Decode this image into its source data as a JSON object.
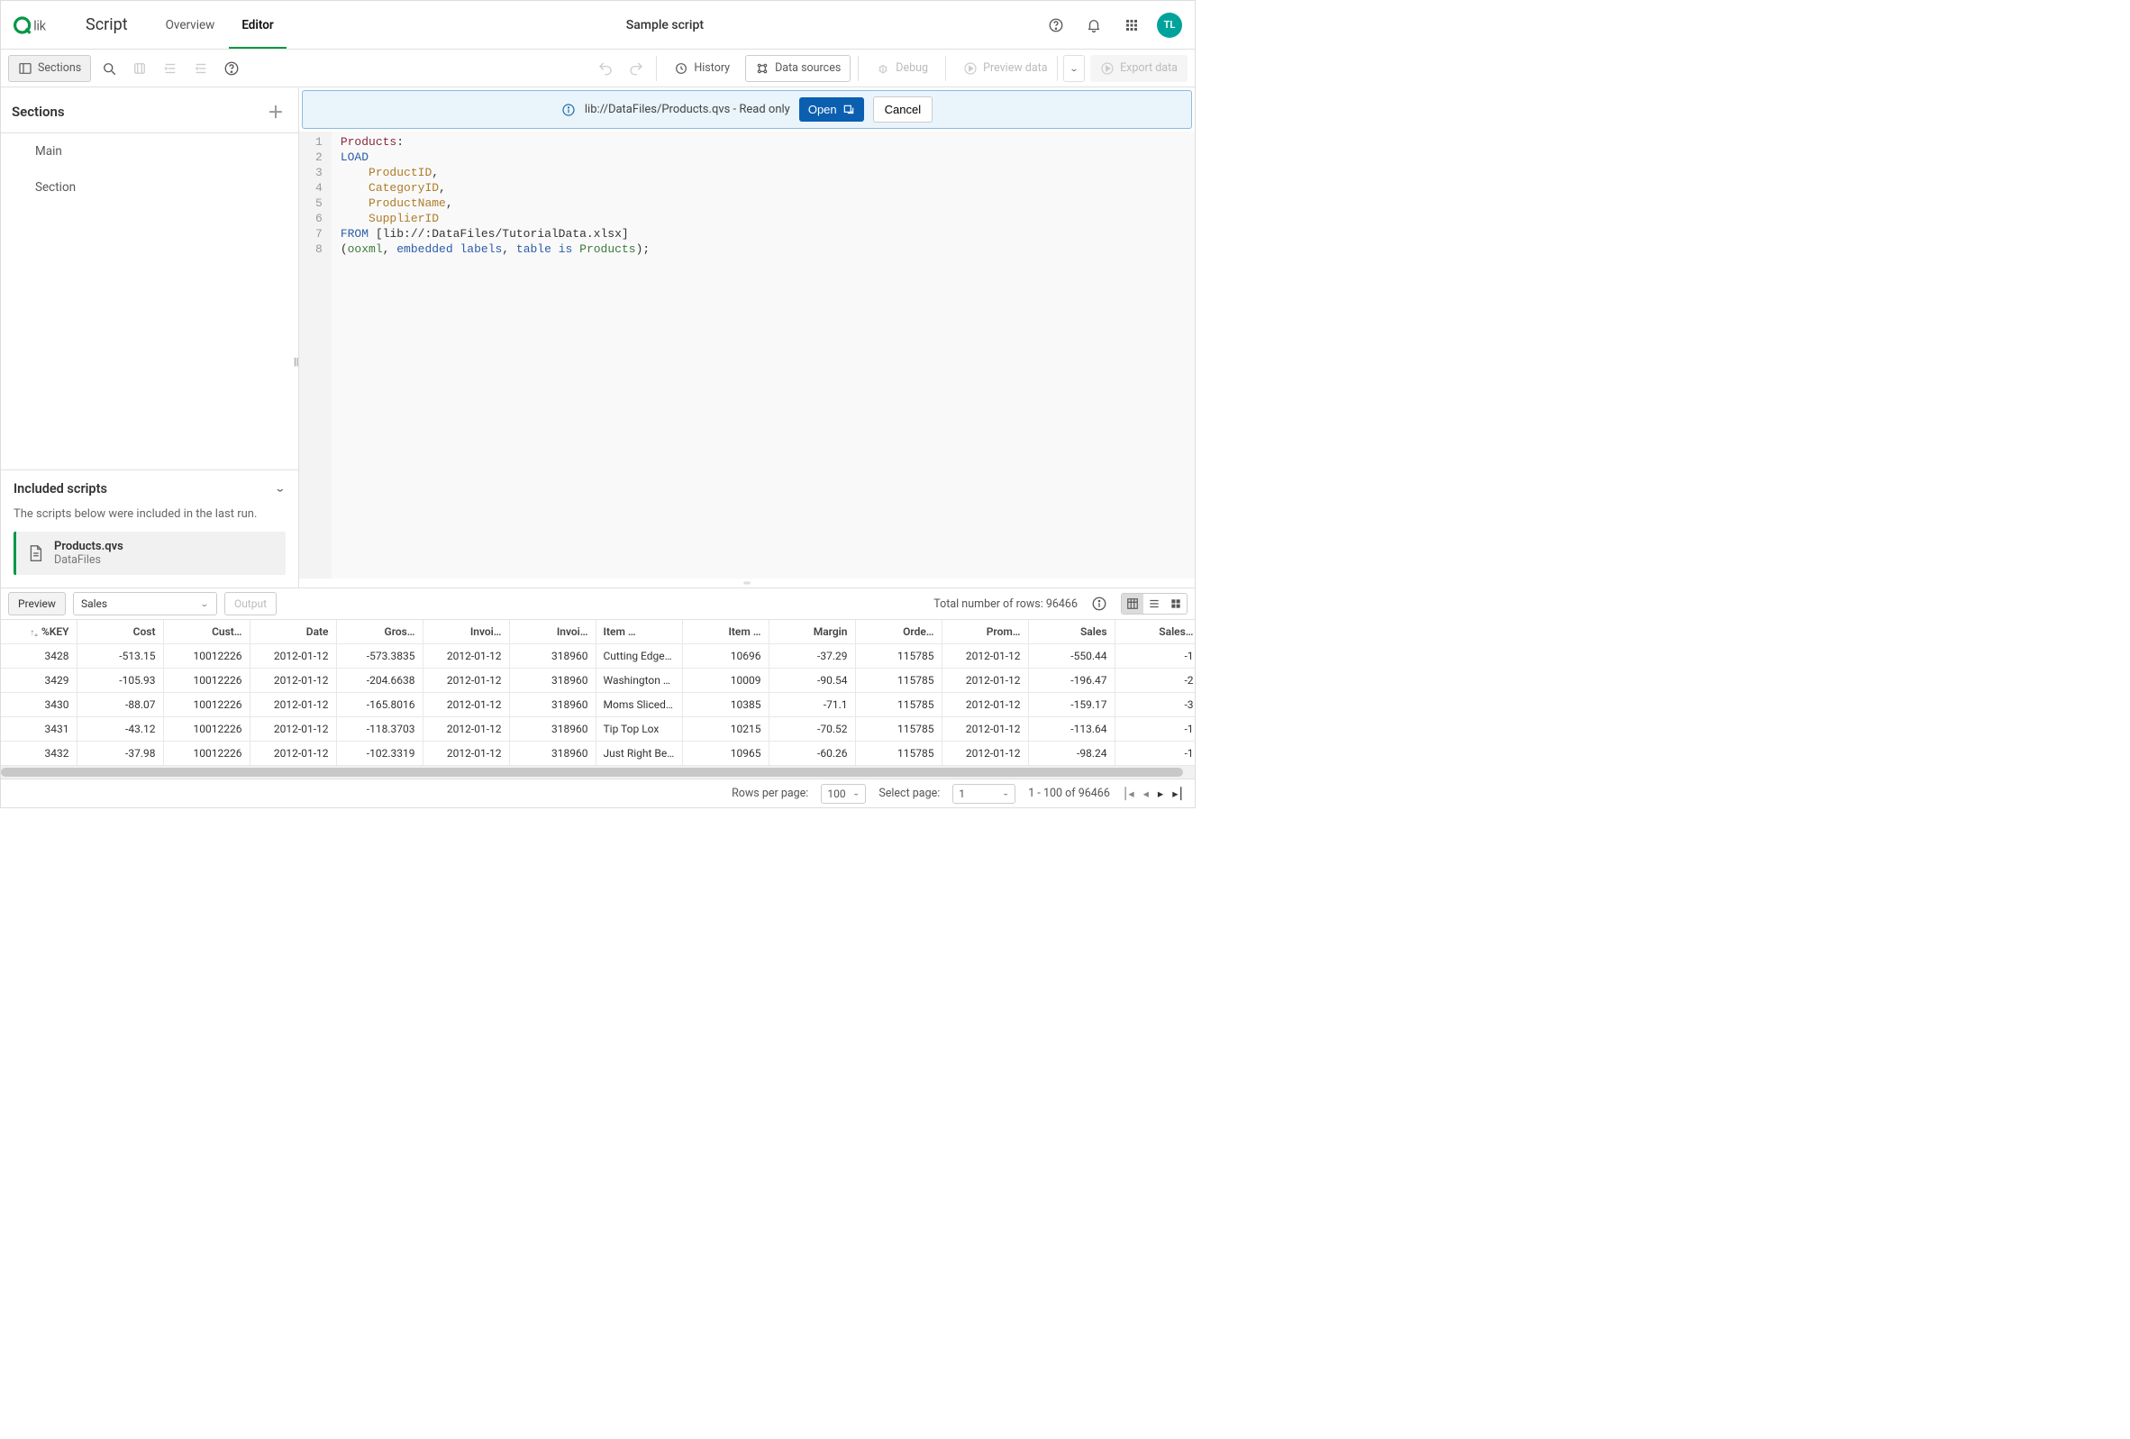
{
  "header": {
    "script_label": "Script",
    "tabs": [
      "Overview",
      "Editor"
    ],
    "active_tab": 1,
    "title": "Sample script",
    "avatar": "TL"
  },
  "toolbar": {
    "sections": "Sections",
    "history": "History",
    "data_sources": "Data sources",
    "debug": "Debug",
    "preview_data": "Preview data",
    "export_data": "Export data"
  },
  "sidebar": {
    "title": "Sections",
    "items": [
      "Main",
      "Section"
    ],
    "included": {
      "title": "Included scripts",
      "desc": "The scripts below were included in the last run.",
      "item": {
        "name": "Products.qvs",
        "loc": "DataFiles"
      }
    }
  },
  "banner": {
    "path": "lib://DataFiles/Products.qvs - Read only",
    "open": "Open",
    "cancel": "Cancel"
  },
  "code": {
    "lines": [
      {
        "n": 1,
        "tokens": [
          [
            "tab",
            "Products"
          ],
          [
            "p",
            ":"
          ]
        ]
      },
      {
        "n": 2,
        "tokens": [
          [
            "kw",
            "LOAD"
          ]
        ]
      },
      {
        "n": 3,
        "tokens": [
          [
            "p",
            "    "
          ],
          [
            "fld",
            "ProductID"
          ],
          [
            "p",
            ","
          ]
        ]
      },
      {
        "n": 4,
        "tokens": [
          [
            "p",
            "    "
          ],
          [
            "fld",
            "CategoryID"
          ],
          [
            "p",
            ","
          ]
        ]
      },
      {
        "n": 5,
        "tokens": [
          [
            "p",
            "    "
          ],
          [
            "fld",
            "ProductName"
          ],
          [
            "p",
            ","
          ]
        ]
      },
      {
        "n": 6,
        "tokens": [
          [
            "p",
            "    "
          ],
          [
            "fld",
            "SupplierID"
          ]
        ]
      },
      {
        "n": 7,
        "tokens": [
          [
            "kw",
            "FROM"
          ],
          [
            "p",
            " ["
          ],
          [
            "str",
            "lib://:DataFiles/TutorialData.xlsx"
          ],
          [
            "p",
            "]"
          ]
        ]
      },
      {
        "n": 8,
        "tokens": [
          [
            "p",
            "("
          ],
          [
            "fn",
            "ooxml"
          ],
          [
            "p",
            ", "
          ],
          [
            "kw",
            "embedded"
          ],
          [
            "p",
            " "
          ],
          [
            "kw",
            "labels"
          ],
          [
            "p",
            ", "
          ],
          [
            "kw",
            "table"
          ],
          [
            "p",
            " "
          ],
          [
            "kw",
            "is"
          ],
          [
            "p",
            " "
          ],
          [
            "fn",
            "Products"
          ],
          [
            "p",
            ");"
          ]
        ]
      }
    ]
  },
  "preview": {
    "tab": "Preview",
    "select": "Sales",
    "output": "Output",
    "rowcount_label": "Total number of rows:",
    "rowcount": "96466",
    "headers": [
      "%KEY",
      "Cost",
      "Cust…",
      "Date",
      "Gros…",
      "Invoi…",
      "Invoi…",
      "Item …",
      "Item …",
      "Margin",
      "Orde…",
      "Prom…",
      "Sales",
      "Sales…"
    ],
    "align_left": [
      7
    ],
    "rows": [
      [
        "3428",
        "-513.15",
        "10012226",
        "2012-01-12",
        "-573.3835",
        "2012-01-12",
        "318960",
        "Cutting Edge Slic",
        "10696",
        "-37.29",
        "115785",
        "2012-01-12",
        "-550.44",
        "-1"
      ],
      [
        "3429",
        "-105.93",
        "10012226",
        "2012-01-12",
        "-204.6638",
        "2012-01-12",
        "318960",
        "Washington Cran",
        "10009",
        "-90.54",
        "115785",
        "2012-01-12",
        "-196.47",
        "-2"
      ],
      [
        "3430",
        "-88.07",
        "10012226",
        "2012-01-12",
        "-165.8016",
        "2012-01-12",
        "318960",
        "Moms Sliced Ham",
        "10385",
        "-71.1",
        "115785",
        "2012-01-12",
        "-159.17",
        "-3"
      ],
      [
        "3431",
        "-43.12",
        "10012226",
        "2012-01-12",
        "-118.3703",
        "2012-01-12",
        "318960",
        "Tip Top Lox",
        "10215",
        "-70.52",
        "115785",
        "2012-01-12",
        "-113.64",
        "-1"
      ],
      [
        "3432",
        "-37.98",
        "10012226",
        "2012-01-12",
        "-102.3319",
        "2012-01-12",
        "318960",
        "Just Right Beef S",
        "10965",
        "-60.26",
        "115785",
        "2012-01-12",
        "-98.24",
        "-1"
      ]
    ]
  },
  "pagination": {
    "rows_per_page_label": "Rows per page:",
    "rows_per_page": "100",
    "select_page_label": "Select page:",
    "page": "1",
    "range": "1 - 100 of 96466"
  }
}
